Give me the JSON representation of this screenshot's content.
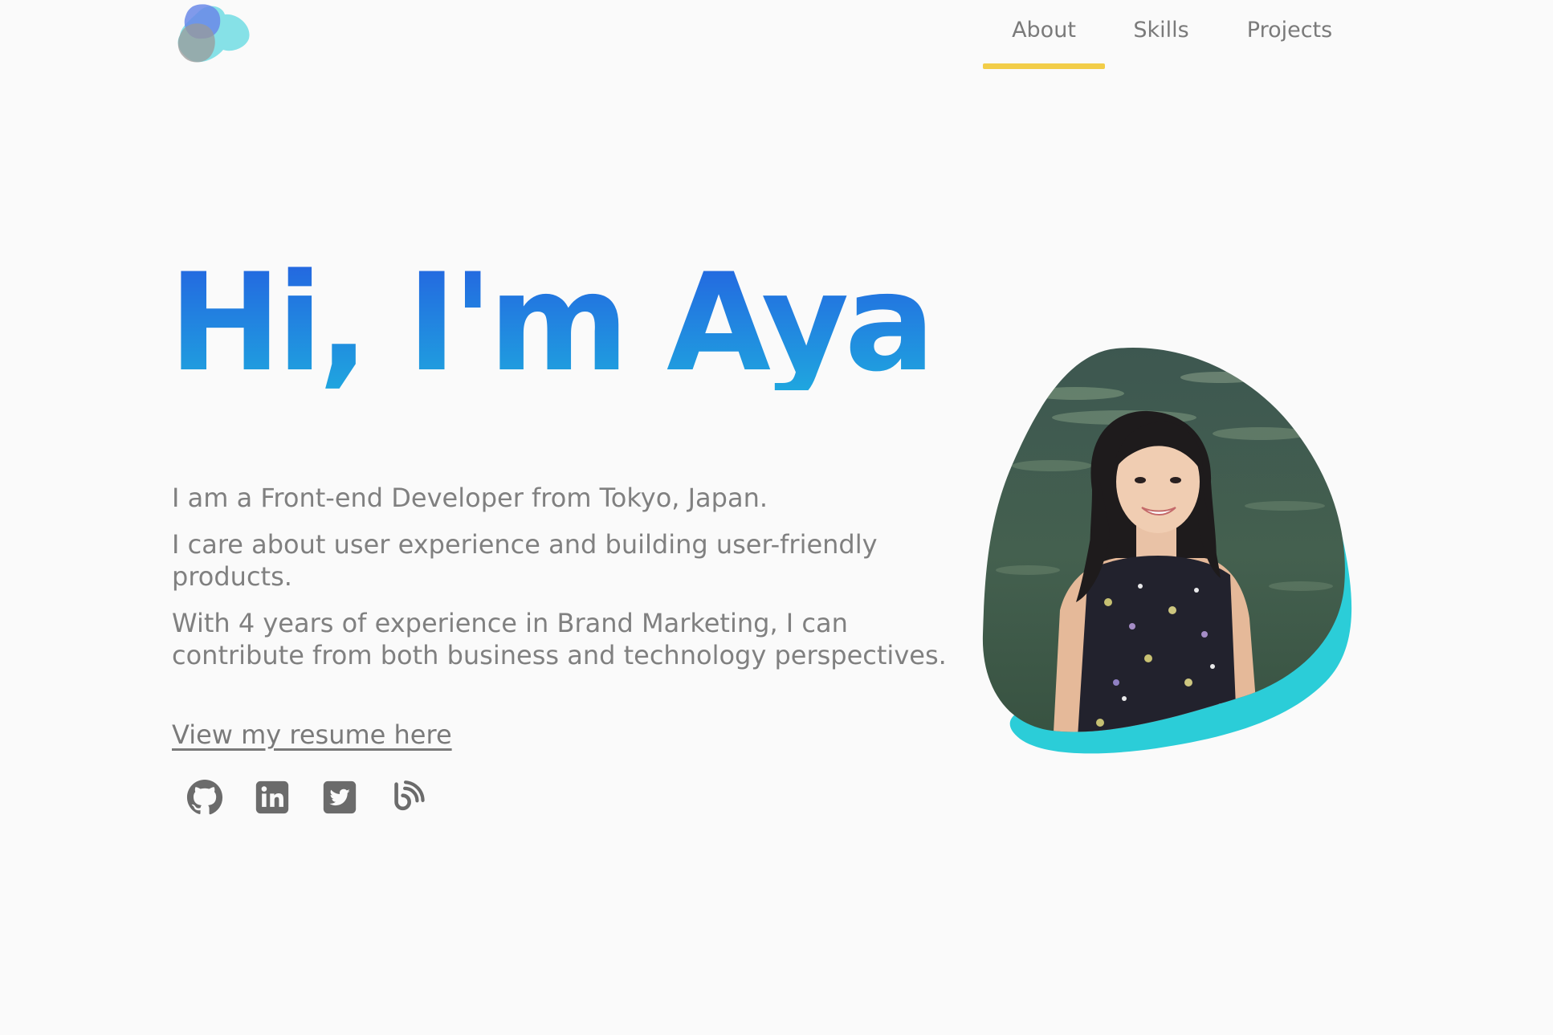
{
  "nav": {
    "items": [
      {
        "label": "About",
        "active": true
      },
      {
        "label": "Skills",
        "active": false
      },
      {
        "label": "Projects",
        "active": false
      }
    ],
    "active_color": "#f2cd48"
  },
  "hero": {
    "headline": "Hi, I'm Aya",
    "headline_gradient": [
      "#2463e0",
      "#1fa6df"
    ],
    "paragraphs": [
      "I am a Front-end Developer from Tokyo, Japan.",
      "I care about user experience and building user-friendly products.",
      "With 4 years of experience in Brand Marketing, I can contribute from both business and technology perspectives."
    ],
    "resume_link": "View my resume here"
  },
  "socials": [
    {
      "icon": "github-icon"
    },
    {
      "icon": "linkedin-icon"
    },
    {
      "icon": "twitter-icon"
    },
    {
      "icon": "blog-icon"
    }
  ],
  "portrait": {
    "accent_color": "#2bcdd8"
  }
}
